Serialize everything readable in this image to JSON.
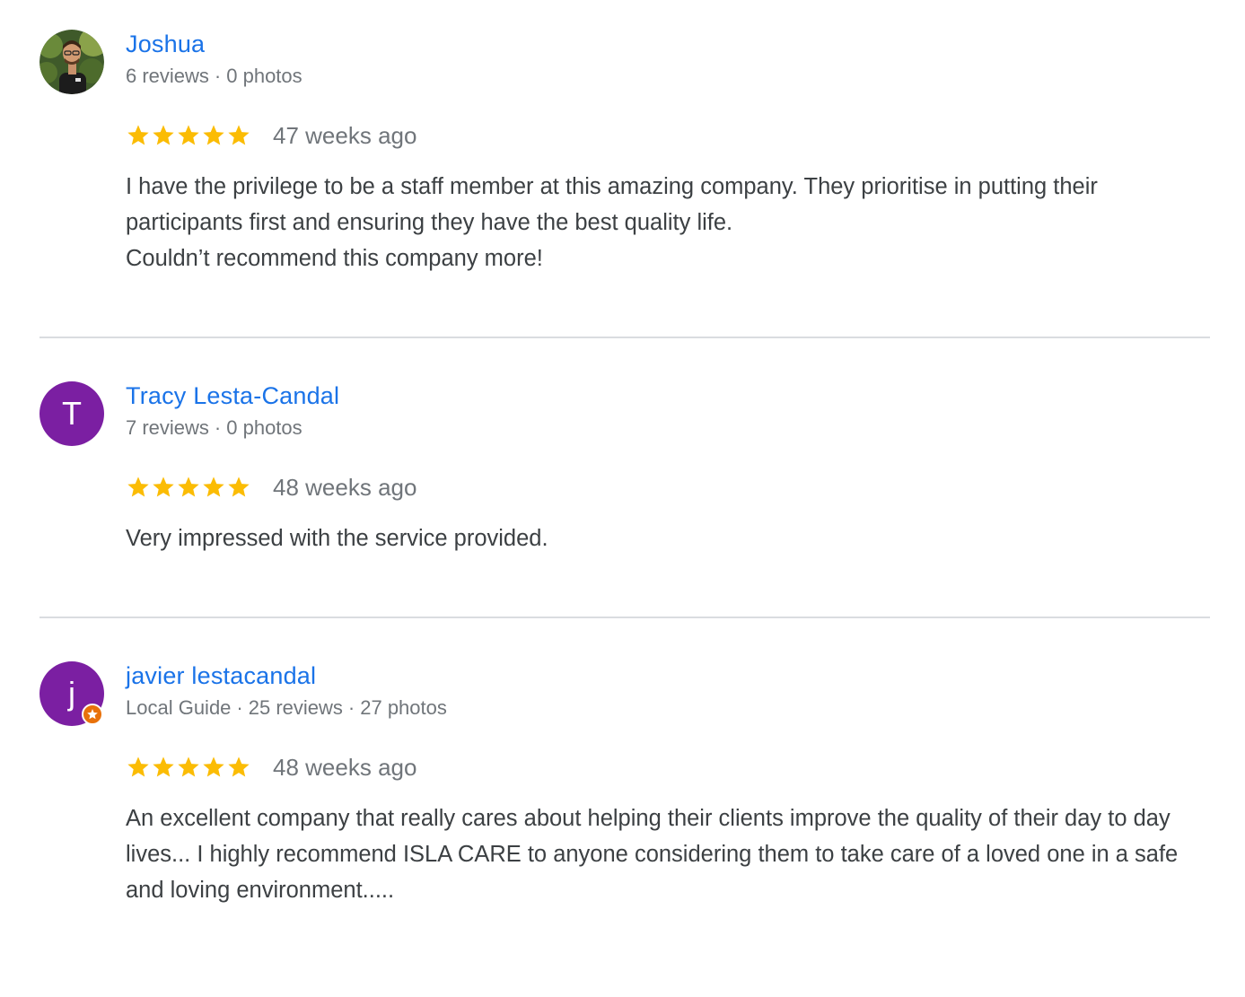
{
  "reviews": [
    {
      "author": "Joshua",
      "meta": [
        "6 reviews",
        "0 photos"
      ],
      "avatar": {
        "type": "photo",
        "icon": "user-photo-avatar"
      },
      "rating": 5,
      "time": "47 weeks ago",
      "text": "I have the privilege to be a staff member at this amazing company. They prioritise in putting their participants first and ensuring they have the best quality life.\nCouldn’t recommend this company more!"
    },
    {
      "author": "Tracy Lesta-Candal",
      "meta": [
        "7 reviews",
        "0 photos"
      ],
      "avatar": {
        "type": "letter",
        "letter": "T",
        "color": "#7b1fa2"
      },
      "rating": 5,
      "time": "48 weeks ago",
      "text": "Very impressed with the service provided."
    },
    {
      "author": "javier lestacandal",
      "meta": [
        "Local Guide",
        "25 reviews",
        "27 photos"
      ],
      "avatar": {
        "type": "letter",
        "letter": "j",
        "color": "#7b1fa2",
        "badge": "local-guide-star-icon"
      },
      "rating": 5,
      "time": "48 weeks ago",
      "text": "An excellent company that really cares about helping their clients improve the quality of their day to day lives... I highly recommend ISLA CARE to anyone considering them to take care of a loved one in a safe and loving environment....."
    }
  ],
  "colors": {
    "author_link": "#1a73e8",
    "meta": "#70757a",
    "body_text": "#3c4043",
    "star": "#fbbc04",
    "divider": "#dadce0",
    "avatar_bg": "#7b1fa2",
    "local_guide_badge": "#e8710a"
  }
}
